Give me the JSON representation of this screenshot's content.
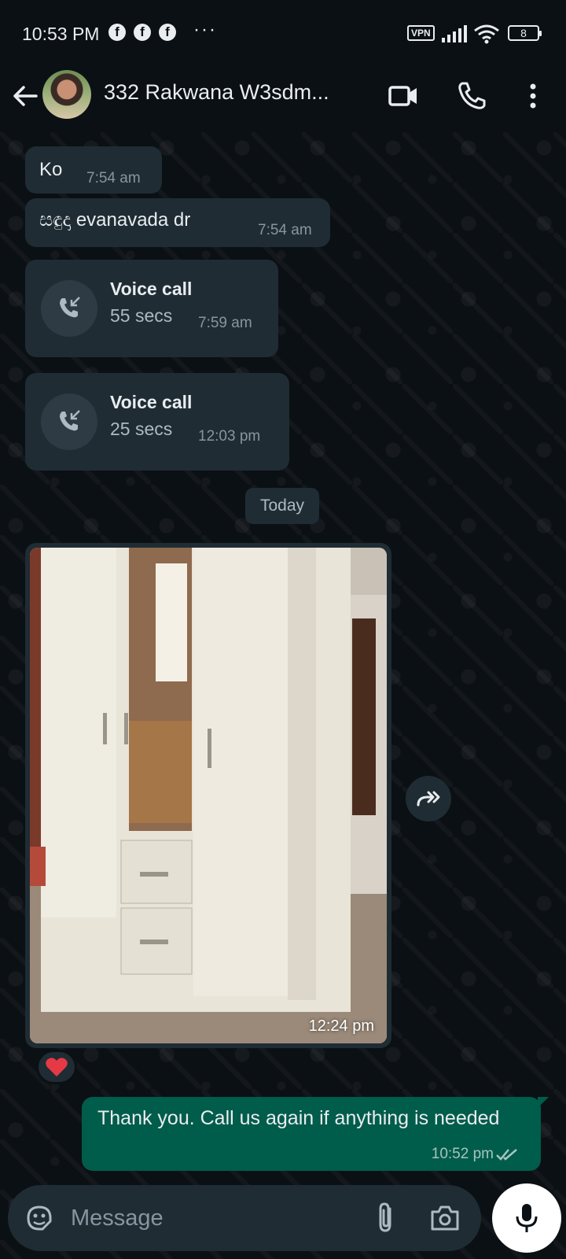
{
  "status_bar": {
    "time": "10:53 PM",
    "fb_glyph": "f",
    "more": "···",
    "vpn": "VPN",
    "battery": "8"
  },
  "header": {
    "contact_name": "332 Rakwana W3sdm...",
    "icons": [
      "back-arrow-icon",
      "video-camera-icon",
      "phone-icon",
      "more-vert-icon"
    ]
  },
  "messages": [
    {
      "type": "text",
      "text": "Ko",
      "time": "7:54 am"
    },
    {
      "type": "text",
      "text": "සඳුදා evanavada dr",
      "time": "7:54 am"
    },
    {
      "type": "call",
      "title": "Voice call",
      "duration": "55 secs",
      "time": "7:59 am"
    },
    {
      "type": "call",
      "title": "Voice call",
      "duration": "25 secs",
      "time": "12:03 pm"
    }
  ],
  "date_divider": "Today",
  "image_message": {
    "time": "12:24 pm",
    "reaction": "heart"
  },
  "outgoing": {
    "text": "Thank you. Call us again if anything is needed",
    "time": "10:52 pm"
  },
  "composer": {
    "placeholder": "Message"
  },
  "colors": {
    "incoming": "#1f2c34",
    "outgoing": "#005c4b",
    "background": "#0b1014"
  }
}
